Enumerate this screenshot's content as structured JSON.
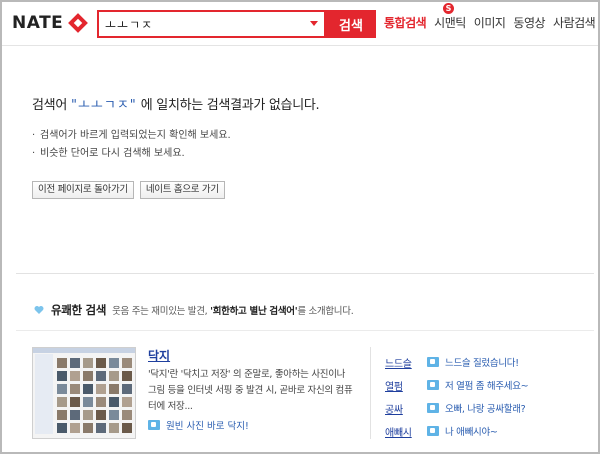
{
  "header": {
    "logo_text": "NATE",
    "search_value": "ㅗㅗㄱㅈ",
    "search_button": "검색",
    "nav": [
      "통합검색",
      "시맨틱",
      "이미지",
      "동영상",
      "사람검색"
    ],
    "nav_badge": "S"
  },
  "no_result": {
    "prefix": "검색어",
    "query": "\"ㅗㅗㄱㅈ\"",
    "suffix": "에 일치하는 검색결과가 없습니다.",
    "tips": [
      "검색어가 바르게 입력되었는지 확인해 보세요.",
      "비슷한 단어로 다시 검색해 보세요."
    ],
    "buttons": [
      "이전 페이지로 돌아가기",
      "네이트 홈으로 가기"
    ]
  },
  "fun_search": {
    "title": "유쾌한 검색",
    "desc_pre": "웃음 주는 재미있는 발견,",
    "desc_bold": "'희한하고 별난 검색어'",
    "desc_post": "를 소개합니다.",
    "featured": {
      "title": "닥지",
      "desc": "'닥지'란 '닥치고 저장' 의 준말로, 좋아하는 사진이나 그림 등을 인터넷 서핑 중 발견 시, 곧바로 자신의 컴퓨터에 저장...",
      "link": "원빈 사진 바로 닥지!"
    },
    "words": [
      {
        "word": "느드슬",
        "desc": "느드슬 질렀습니다!"
      },
      {
        "word": "열펌",
        "desc": "저 열펌 좀 해주세요~"
      },
      {
        "word": "공싸",
        "desc": "오빠, 나랑 공싸할래?"
      },
      {
        "word": "애빼시",
        "desc": "나 애빼시야~"
      }
    ]
  },
  "colors": {
    "brand": "#e3262e",
    "link": "#2a5db0",
    "icon": "#5fb3e6"
  }
}
